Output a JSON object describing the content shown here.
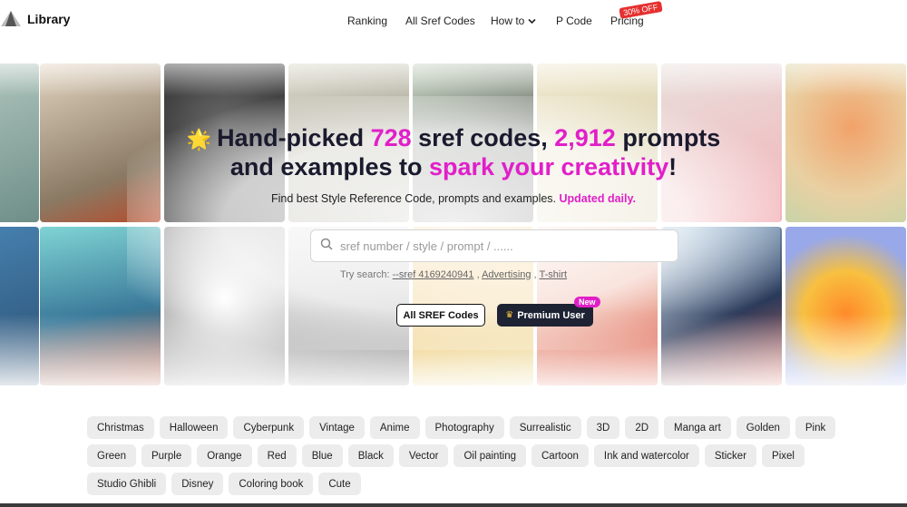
{
  "header": {
    "logo_text": "Library",
    "nav": [
      {
        "label": "Ranking",
        "name": "nav-ranking"
      },
      {
        "label": "All Sref Codes",
        "name": "nav-all-sref-codes"
      },
      {
        "label": "How to",
        "name": "nav-how-to",
        "dropdown": true
      },
      {
        "label": "P Code",
        "name": "nav-p-code"
      },
      {
        "label": "Pricing",
        "name": "nav-pricing"
      }
    ],
    "pricing_badge": "30% OFF"
  },
  "hero": {
    "headline": {
      "emoji": "🌟",
      "part1": "Hand-picked ",
      "sref_count": "728",
      "part2": " sref codes, ",
      "prompt_count": "2,912",
      "part3": " prompts",
      "part4": "and examples to ",
      "highlight": "spark your creativity",
      "part5": "!"
    },
    "subline": "Find best Style Reference Code, prompts and examples. ",
    "subline_highlight": "Updated daily.",
    "search_placeholder": "sref number / style / prompt / ......",
    "try_label": "Try search: ",
    "try_links": [
      "--sref 4169240941",
      "Advertising",
      "T-shirt"
    ],
    "try_separator": " , ",
    "btn_all": "All SREF Codes",
    "btn_premium": "Premium User",
    "new_badge": "New"
  },
  "tags": [
    "Christmas",
    "Halloween",
    "Cyberpunk",
    "Vintage",
    "Anime",
    "Photography",
    "Surrealistic",
    "3D",
    "2D",
    "Manga art",
    "Golden",
    "Pink",
    "Green",
    "Purple",
    "Orange",
    "Red",
    "Blue",
    "Black",
    "Vector",
    "Oil painting",
    "Cartoon",
    "Ink and watercolor",
    "Sticker",
    "Pixel",
    "Studio Ghibli",
    "Disney",
    "Coloring book",
    "Cute"
  ],
  "colors": {
    "accent": "#e11fc9",
    "premium_bg": "#1d2333",
    "badge": "#e53030"
  }
}
